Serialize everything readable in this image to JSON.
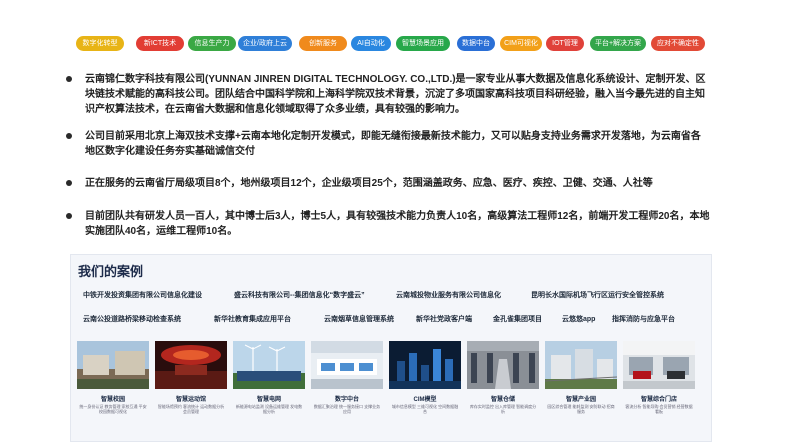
{
  "tags": [
    {
      "label": "数字化转型",
      "color": "#e8b416"
    },
    {
      "label": "新ICT技术",
      "color": "#e23d34"
    },
    {
      "label": "信息生产力",
      "color": "#3aa844"
    },
    {
      "label": "企业/政府上云",
      "color": "#2f7fd8"
    },
    {
      "label": "创新服务",
      "color": "#f08a1c"
    },
    {
      "label": "AI自动化",
      "color": "#2a87e0"
    },
    {
      "label": "智慧场景应用",
      "color": "#27a84a"
    },
    {
      "label": "数据中台",
      "color": "#2a6fd6"
    },
    {
      "label": "CIM可视化",
      "color": "#f2a019"
    },
    {
      "label": "IOT管理",
      "color": "#e0413a"
    },
    {
      "label": "平台+解决方案",
      "color": "#33a64b"
    },
    {
      "label": "应对不确定性",
      "color": "#e24a36"
    }
  ],
  "bullets": [
    "云南锦仁数字科技有限公司(YUNNAN JINREN DIGITAL TECHNOLOGY. CO.,LTD.)是一家专业从事大数据及信息化系统设计、定制开发、区块链技术赋能的高科技公司。团队结合中国科学院和上海科学院双技术背景，沉淀了多项国家高科技项目科研经验，融入当今最先进的自主知识产权算法技术，在云南省大数据和信息化领域取得了众多业绩，具有较强的影响力。",
    "公司目前采用北京上海双技术支撑+云南本地化定制开发模式，即能无缝衔接最新技术能力，又可以贴身支持业务需求开发落地，为云南省各地区数字化建设任务夯实基础诚信交付",
    "正在服务的云南省厅局级项目8个，地州级项目12个，企业级项目25个，范围涵盖政务、应急、医疗、疾控、卫健、交通、人社等",
    "目前团队共有研发人员一百人，其中博士后3人，博士5人，具有较强技术能力负责人10名，高级算法工程师12名，前端开发工程师20名，本地实施团队40名，运维工程师10名。"
  ],
  "cases": {
    "title": "我们的案例",
    "clients_row1": [
      "中铁开发投资集团有限公司信息化建设",
      "盛云科技有限公司--集团信息化“数字盛云”",
      "云南城投物业服务有限公司信息化",
      "昆明长水国际机场飞行区运行安全管控系统"
    ],
    "clients_row2": [
      "云南公投道路桥梁移动检查系统",
      "新华社教育集成应用平台",
      "云南烟草信息管理系统",
      "新华社党政客户端",
      "金孔雀集团项目",
      "云悠悠app",
      "指挥消防与应急平台"
    ],
    "cards": [
      {
        "title": "智慧校园",
        "desc": "统一身份认证 教务管理 家校互通 平安校园数据可视化"
      },
      {
        "title": "智慧运动馆",
        "desc": "智能场馆预约 客流统计 运动数据分析 会员管理"
      },
      {
        "title": "智慧电网",
        "desc": "新能源电站监测 设备运维管理 发电数据分析"
      },
      {
        "title": "数字中台",
        "desc": "数据汇聚治理 统一服务接口 支撑业务应用"
      },
      {
        "title": "CIM模型",
        "desc": "城市信息模型 三维可视化 空间数据融合"
      },
      {
        "title": "智慧仓储",
        "desc": "库存实时监控 出入库管理 智能调度分析"
      },
      {
        "title": "智慧产业园",
        "desc": "园区综合管理 能耗监测 安防联动 招商服务"
      },
      {
        "title": "智慧综合门店",
        "desc": "客流分析 智能导购 会员营销 经营数据看板"
      }
    ]
  }
}
